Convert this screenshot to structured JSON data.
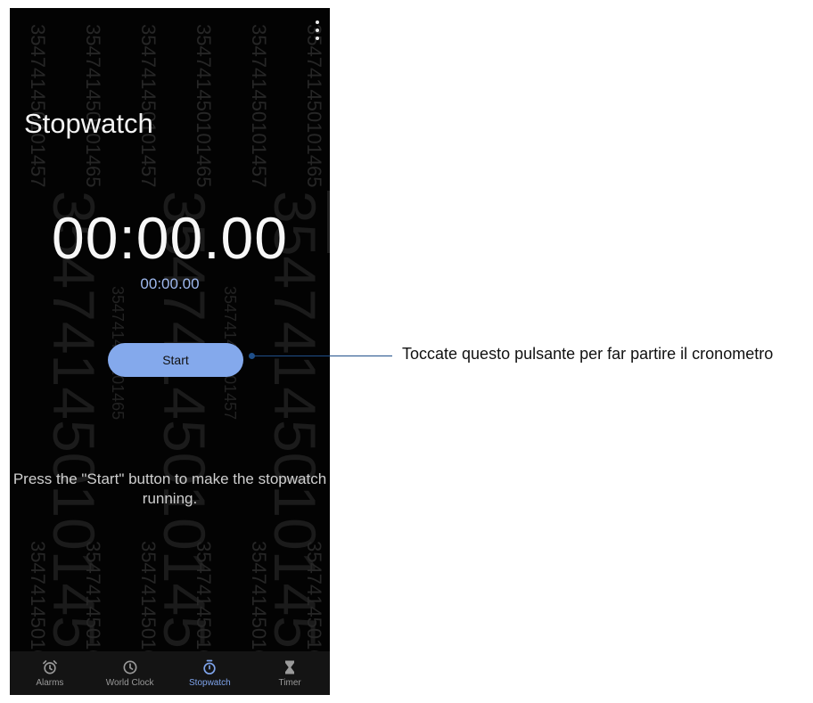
{
  "watermark": {
    "small_text": "354741450101457",
    "small_text_alt": "354741450101465",
    "big_text": "354741450101457",
    "mid_text": "354741450101465"
  },
  "header": {
    "title": "Stopwatch",
    "menu_icon": "more-vert-icon"
  },
  "stopwatch": {
    "main_time": "00:00.00",
    "lap_time": "00:00.00",
    "start_label": "Start",
    "hint": "Press the \"Start\" button to make the stopwatch running."
  },
  "tabs": [
    {
      "label": "Alarms",
      "icon": "alarm-icon"
    },
    {
      "label": "World Clock",
      "icon": "clock-icon"
    },
    {
      "label": "Stopwatch",
      "icon": "stopwatch-icon",
      "active": true
    },
    {
      "label": "Timer",
      "icon": "hourglass-icon"
    }
  ],
  "annotation": {
    "text": "Toccate questo pulsante per far partire il cronometro"
  },
  "colors": {
    "accent": "#84a9ec",
    "background": "#030303",
    "annotation_line": "#1f4f8a"
  }
}
